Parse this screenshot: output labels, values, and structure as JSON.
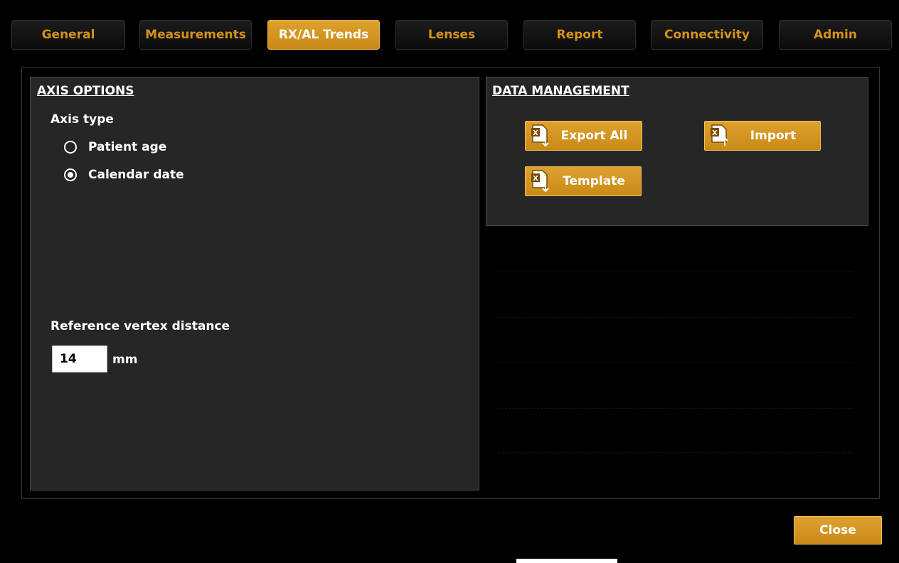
{
  "tabs": [
    {
      "label": "General",
      "active": false
    },
    {
      "label": "Measurements",
      "active": false
    },
    {
      "label": "RX/AL Trends",
      "active": true
    },
    {
      "label": "Lenses",
      "active": false
    },
    {
      "label": "Report",
      "active": false
    },
    {
      "label": "Connectivity",
      "active": false
    },
    {
      "label": "Admin",
      "active": false
    }
  ],
  "axis_options": {
    "title": "AXIS OPTIONS",
    "axis_type_label": "Axis type",
    "options": [
      {
        "label": "Patient age",
        "selected": false
      },
      {
        "label": "Calendar date",
        "selected": true
      }
    ],
    "vertex_label": "Reference vertex distance",
    "vertex_value": "14",
    "vertex_unit": "mm"
  },
  "data_management": {
    "title": "DATA MANAGEMENT",
    "export_all_label": "Export All",
    "import_label": "Import",
    "template_label": "Template"
  },
  "footer": {
    "close_label": "Close"
  },
  "colors": {
    "accent": "#d4921a",
    "button_gold": "#d99a22",
    "panel_bg": "#262626",
    "background": "#000000"
  },
  "icons": {
    "excel_export": "excel-export-icon",
    "excel_import": "excel-import-icon"
  }
}
